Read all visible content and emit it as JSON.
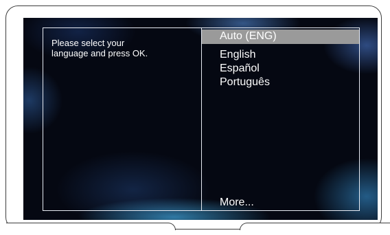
{
  "dialog": {
    "instruction_line1": "Please select your",
    "instruction_line2": "language and press OK."
  },
  "language_menu": {
    "items": [
      {
        "label": "Auto (ENG)",
        "selected": true
      },
      {
        "label": "English",
        "selected": false
      },
      {
        "label": "Español",
        "selected": false
      },
      {
        "label": "Português",
        "selected": false
      }
    ],
    "more_label": "More..."
  },
  "colors": {
    "highlight": "#9a9a9a",
    "text": "#ffffff",
    "panel_border": "#e8ecf4",
    "background": "#050812"
  }
}
